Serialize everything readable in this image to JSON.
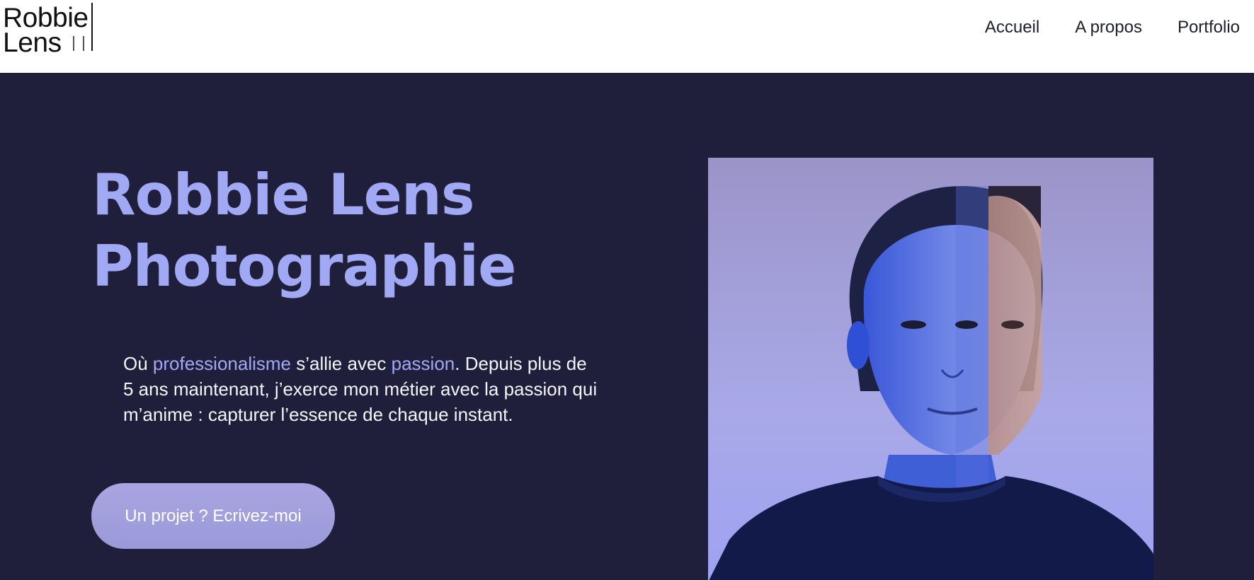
{
  "header": {
    "logo": {
      "line1": "Robbie",
      "line2": "Lens"
    },
    "nav": [
      {
        "label": "Accueil"
      },
      {
        "label": "A propos"
      },
      {
        "label": "Portfolio"
      }
    ]
  },
  "hero": {
    "title_line1": "Robbie Lens",
    "title_line2": "Photographie",
    "intro": {
      "prefix": "Où ",
      "highlight1": "professionalisme",
      "middle": " s’allie avec ",
      "highlight2": "passion",
      "suffix": ". Depuis plus de 5 ans maintenant, j’exerce mon métier avec la passion qui m’anime : capturer l’essence de chaque instant."
    },
    "cta_label": "Un projet ? Ecrivez-moi",
    "accent_color": "#a1a8f4",
    "background_color": "#1f1f3b"
  },
  "photo": {
    "subject": "portrait-photo"
  }
}
